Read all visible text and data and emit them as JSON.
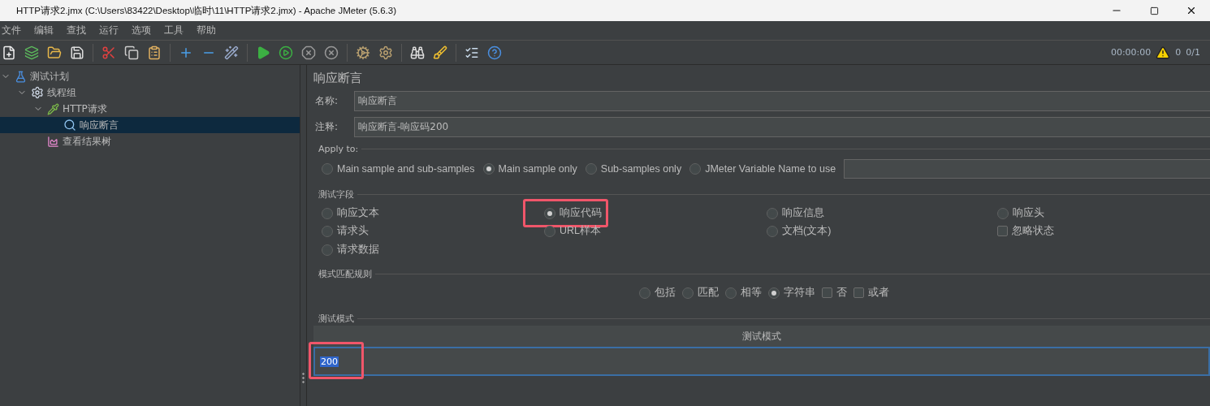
{
  "window": {
    "title": "HTTP请求2.jmx (C:\\Users\\83422\\Desktop\\临时\\11\\HTTP请求2.jmx) - Apache JMeter (5.6.3)"
  },
  "menu": [
    "文件",
    "编辑",
    "查找",
    "运行",
    "选项",
    "工具",
    "帮助"
  ],
  "status": {
    "elapsed": "00:00:00",
    "warnings": "0",
    "threads": "0/1"
  },
  "tree": [
    {
      "label": "测试计划",
      "kind": "plan",
      "expanded": true,
      "selected": false,
      "children": [
        {
          "label": "线程组",
          "kind": "threads",
          "expanded": true,
          "selected": false,
          "children": [
            {
              "label": "HTTP请求",
              "kind": "sampler",
              "expanded": true,
              "selected": false,
              "children": [
                {
                  "label": "响应断言",
                  "kind": "assertion",
                  "selected": true
                }
              ]
            },
            {
              "label": "查看结果树",
              "kind": "listener",
              "selected": false
            }
          ]
        }
      ]
    }
  ],
  "panel": {
    "title": "响应断言",
    "name_label": "名称:",
    "name_value": "响应断言",
    "comment_label": "注释:",
    "comment_value": "响应断言-响应码200",
    "apply_to": {
      "legend": "Apply to:",
      "options": [
        {
          "label": "Main sample and sub-samples",
          "selected": false
        },
        {
          "label": "Main sample only",
          "selected": true
        },
        {
          "label": "Sub-samples only",
          "selected": false
        },
        {
          "label": "JMeter Variable Name to use",
          "selected": false
        }
      ]
    },
    "field_to_test": {
      "legend": "测试字段",
      "items": [
        {
          "label": "响应文本",
          "kind": "radio",
          "selected": false,
          "highlighted": false
        },
        {
          "label": "响应代码",
          "kind": "radio",
          "selected": true,
          "highlighted": true
        },
        {
          "label": "响应信息",
          "kind": "radio",
          "selected": false,
          "highlighted": false
        },
        {
          "label": "响应头",
          "kind": "radio",
          "selected": false,
          "highlighted": false
        },
        {
          "label": "请求头",
          "kind": "radio",
          "selected": false,
          "highlighted": false
        },
        {
          "label": "URL样本",
          "kind": "radio",
          "selected": false,
          "highlighted": false
        },
        {
          "label": "文档(文本)",
          "kind": "radio",
          "selected": false,
          "highlighted": false
        },
        {
          "label": "忽略状态",
          "kind": "checkbox",
          "checked": false,
          "highlighted": false
        },
        {
          "label": "请求数据",
          "kind": "radio",
          "selected": false,
          "highlighted": false
        }
      ]
    },
    "matching_rules": {
      "legend": "模式匹配规则",
      "items": [
        {
          "label": "包括",
          "kind": "radio",
          "selected": false
        },
        {
          "label": "匹配",
          "kind": "radio",
          "selected": false
        },
        {
          "label": "相等",
          "kind": "radio",
          "selected": false
        },
        {
          "label": "字符串",
          "kind": "radio",
          "selected": true
        },
        {
          "label": "否",
          "kind": "checkbox",
          "checked": false
        },
        {
          "label": "或者",
          "kind": "checkbox",
          "checked": false
        }
      ]
    },
    "patterns": {
      "legend": "测试模式",
      "column": "测试模式",
      "rows": [
        {
          "value": "200",
          "highlighted": true
        }
      ]
    }
  }
}
